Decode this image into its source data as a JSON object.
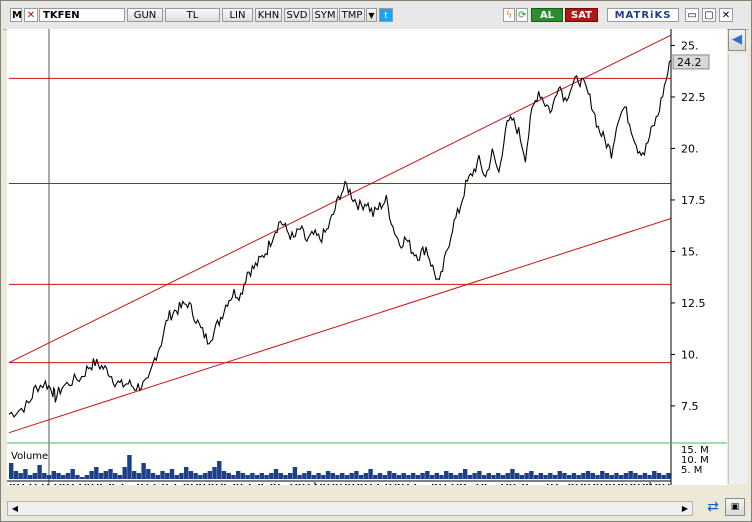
{
  "toolbar": {
    "menu_label": "M",
    "close_label": "✕",
    "symbol": "TKFEN",
    "period": "GUN",
    "currency": "TL",
    "scale": "LIN",
    "khn": "KHN",
    "svd": "SVD",
    "sym": "SYM",
    "tmp": "TMP",
    "buy": "AL",
    "sell": "SAT",
    "logo": "MATRiKS",
    "minimize": "▭",
    "maximize": "▢",
    "close": "✕",
    "dropdown": "▼",
    "twitter": "t",
    "bolt": "ϟ",
    "refresh": "⟳"
  },
  "colors": {
    "price": "#000000",
    "trend": "#c81414",
    "volume": "#1c3f8c",
    "divider": "#3fbf3f",
    "last_price_bg": "#d8d8d8"
  },
  "volume_label": "Volume",
  "chart_data": {
    "type": "line",
    "symbol": "TKFEN",
    "y_ticks": [
      "25.",
      "22.5",
      "20.",
      "17.5",
      "15.",
      "12.5",
      "10.",
      "7.5"
    ],
    "y_tick_values": [
      25,
      22.5,
      20,
      17.5,
      15,
      12.5,
      10,
      7.5
    ],
    "last_price": "24.2",
    "last_value": 24.2,
    "ylim": [
      5.7,
      25.8
    ],
    "x_labels": [
      "18",
      "19"
    ],
    "horizontal_levels": [
      23.4,
      18.3,
      13.4,
      9.6
    ],
    "channel_upper": [
      [
        0,
        9.6
      ],
      [
        100,
        25.5
      ]
    ],
    "channel_lower": [
      [
        0,
        6.2
      ],
      [
        100,
        16.6
      ]
    ],
    "price_series": [
      [
        0,
        7.1
      ],
      [
        1.5,
        7.3
      ],
      [
        3,
        7.6
      ],
      [
        4,
        8.4
      ],
      [
        5.5,
        8.6
      ],
      [
        6.5,
        8.3
      ],
      [
        7,
        7.9
      ],
      [
        8,
        8.4
      ],
      [
        9.5,
        8.7
      ],
      [
        11,
        8.9
      ],
      [
        12,
        9.4
      ],
      [
        13,
        9.6
      ],
      [
        14,
        9.4
      ],
      [
        15,
        9.2
      ],
      [
        16,
        8.7
      ],
      [
        17,
        8.5
      ],
      [
        18,
        8.6
      ],
      [
        19,
        8.4
      ],
      [
        20,
        8.5
      ],
      [
        21,
        8.6
      ],
      [
        22,
        9.8
      ],
      [
        23,
        10.6
      ],
      [
        24,
        11.8
      ],
      [
        25,
        12.1
      ],
      [
        26,
        12.3
      ],
      [
        27,
        12.5
      ],
      [
        28,
        11.9
      ],
      [
        29,
        11.2
      ],
      [
        30,
        10.7
      ],
      [
        31,
        11.1
      ],
      [
        32,
        11.8
      ],
      [
        33,
        12.6
      ],
      [
        34,
        13.0
      ],
      [
        35,
        12.9
      ],
      [
        36,
        14.0
      ],
      [
        37,
        14.2
      ],
      [
        38,
        14.6
      ],
      [
        39,
        15.1
      ],
      [
        40,
        15.9
      ],
      [
        41,
        16.5
      ],
      [
        42,
        16.0
      ],
      [
        43,
        15.6
      ],
      [
        44,
        16.1
      ],
      [
        45,
        15.5
      ],
      [
        46,
        15.8
      ],
      [
        47,
        15.6
      ],
      [
        48,
        16.0
      ],
      [
        49,
        16.8
      ],
      [
        50,
        17.8
      ],
      [
        51,
        18.2
      ],
      [
        52,
        17.6
      ],
      [
        53,
        17.2
      ],
      [
        54,
        17.4
      ],
      [
        55,
        16.8
      ],
      [
        56,
        17.2
      ],
      [
        57,
        17.5
      ],
      [
        58,
        16.2
      ],
      [
        59,
        15.4
      ],
      [
        60,
        15.6
      ],
      [
        61,
        15.0
      ],
      [
        62,
        14.8
      ],
      [
        63,
        15.2
      ],
      [
        64,
        14.2
      ],
      [
        65,
        13.4
      ],
      [
        66,
        14.8
      ],
      [
        67,
        16.2
      ],
      [
        68,
        17.0
      ],
      [
        69,
        18.2
      ],
      [
        70,
        18.8
      ],
      [
        71,
        19.4
      ],
      [
        72,
        18.6
      ],
      [
        73,
        19.8
      ],
      [
        74,
        18.8
      ],
      [
        75,
        21.0
      ],
      [
        76,
        21.4
      ],
      [
        77,
        20.8
      ],
      [
        78,
        19.6
      ],
      [
        79,
        21.8
      ],
      [
        80,
        22.8
      ],
      [
        81,
        22.2
      ],
      [
        82,
        21.8
      ],
      [
        83,
        23.2
      ],
      [
        84,
        22.4
      ],
      [
        85,
        23.0
      ],
      [
        86,
        23.4
      ],
      [
        87,
        23.0
      ],
      [
        88,
        22.2
      ],
      [
        89,
        21.0
      ],
      [
        90,
        20.4
      ],
      [
        91,
        19.8
      ],
      [
        92,
        21.5
      ],
      [
        93,
        22.0
      ],
      [
        94,
        21.0
      ],
      [
        95,
        20.0
      ],
      [
        96,
        19.8
      ],
      [
        97,
        20.8
      ],
      [
        98,
        21.6
      ],
      [
        99,
        23.0
      ],
      [
        100,
        24.3
      ]
    ],
    "volume_ticks": [
      "15. M",
      "10. M",
      "5. M"
    ],
    "volume_tick_values": [
      15,
      10,
      5
    ],
    "volume_unit": "M",
    "volume_ylim": [
      0,
      16
    ],
    "volume": [
      8,
      4,
      3,
      5,
      2,
      3,
      7,
      3,
      2,
      4,
      3,
      2,
      3,
      5,
      2,
      1,
      2,
      4,
      6,
      3,
      4,
      5,
      3,
      2,
      6,
      12,
      4,
      3,
      8,
      5,
      3,
      2,
      4,
      3,
      5,
      2,
      3,
      6,
      4,
      3,
      2,
      3,
      4,
      6,
      9,
      4,
      3,
      2,
      4,
      3,
      2,
      3,
      2,
      3,
      2,
      3,
      5,
      3,
      2,
      3,
      6,
      2,
      3,
      4,
      2,
      3,
      2,
      4,
      3,
      2,
      3,
      2,
      3,
      4,
      2,
      3,
      5,
      2,
      3,
      2,
      4,
      3,
      2,
      3,
      2,
      3,
      2,
      3,
      4,
      2,
      3,
      2,
      4,
      3,
      2,
      3,
      5,
      2,
      3,
      4,
      2,
      3,
      2,
      3,
      2,
      3,
      5,
      3,
      2,
      3,
      4,
      2,
      3,
      2,
      3,
      2,
      4,
      3,
      2,
      3,
      2,
      3,
      4,
      3,
      2,
      4,
      3,
      2,
      3,
      2,
      3,
      4,
      3,
      2,
      3,
      2,
      4,
      3,
      2,
      3
    ]
  }
}
